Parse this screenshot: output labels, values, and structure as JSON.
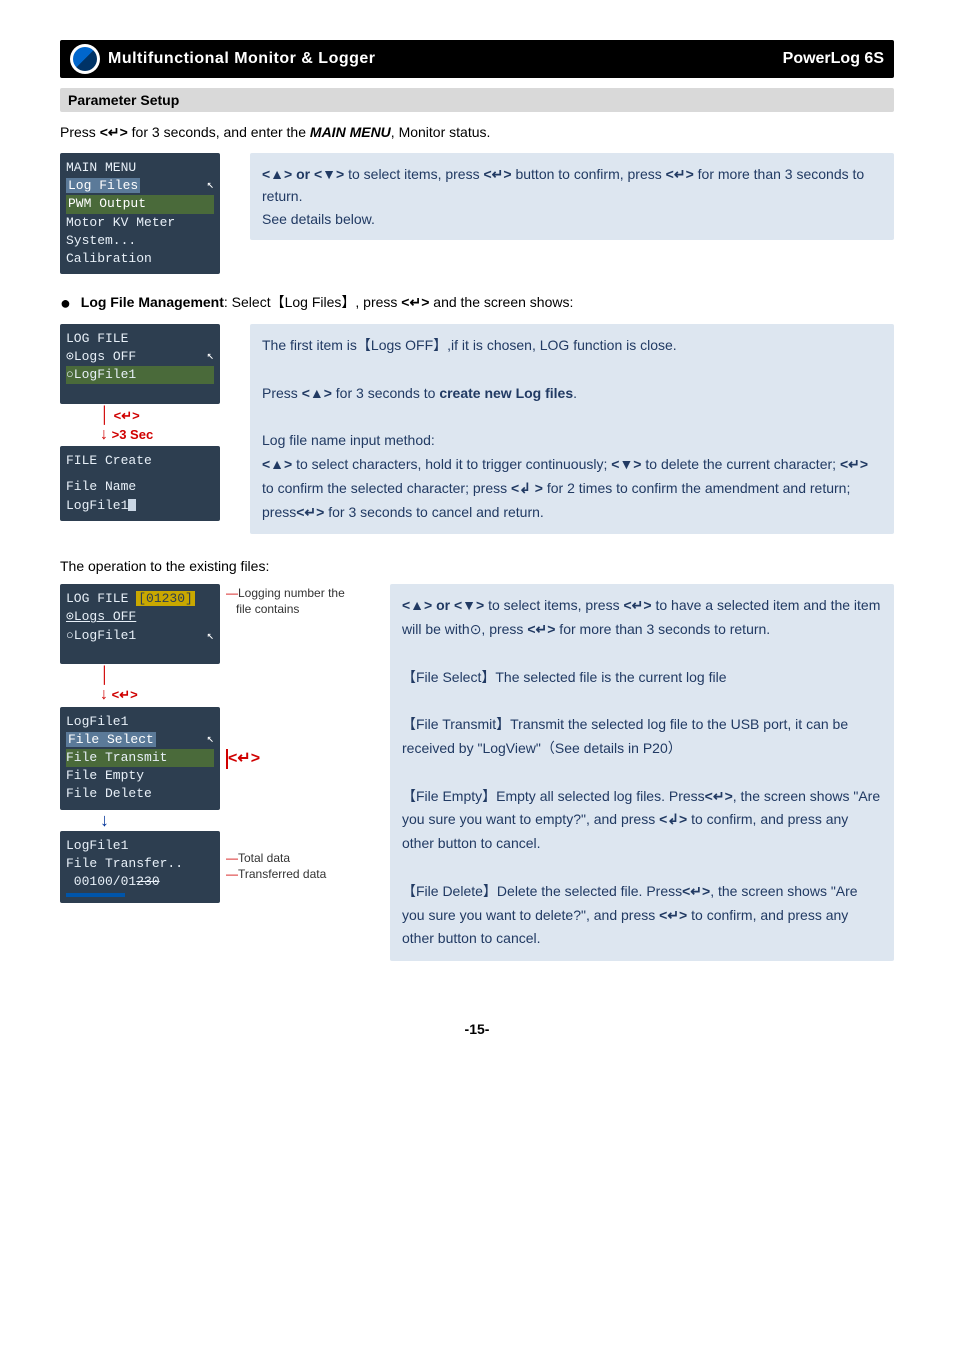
{
  "header": {
    "title": "Multifunctional  Monitor  &  Logger",
    "product": "PowerLog 6S"
  },
  "section_title": "Parameter Setup",
  "intro": {
    "pre": "Press ",
    "btn": "<↵>",
    "post": " for 3 seconds, and enter the ",
    "menu": "MAIN MENU",
    "tail": ", Monitor status."
  },
  "main_menu_lcd": {
    "title": "MAIN MENU",
    "items": [
      "Log Files",
      "PWM Output",
      "Motor KV Meter",
      "System...",
      "Calibration"
    ]
  },
  "main_menu_note": {
    "l1a": "<▲> or <▼>",
    "l1b": " to select items, press ",
    "l1c": "<↵>",
    "l1d": " button to confirm, press ",
    "l1e": "<↵>",
    "l2": "for more than 3 seconds to return.",
    "l3": "See details below."
  },
  "log_mgmt": {
    "label": "Log File Management",
    "mid": ": Select【Log Files】, press ",
    "btn": "<↵>",
    "tail": " and the screen shows:"
  },
  "log_file_lcd": {
    "title": "LOG FILE",
    "row1": "⊙Logs OFF",
    "row2": "○LogFile1"
  },
  "arrow_label": {
    "sym": "<↵>",
    "sec": ">3 Sec"
  },
  "file_create_lcd": {
    "title": "FILE Create",
    "row1": "File Name",
    "row2a": "LogFile1"
  },
  "log_note": {
    "p1a": "The first item is【Logs OFF】,if it is chosen, LOG function is close.",
    "p2a": "Press ",
    "p2b": "<▲>",
    "p2c": " for 3 seconds to ",
    "p2d": "create new Log files",
    "p2e": ".",
    "p3": "Log file name input method:",
    "p4a": "<▲>",
    "p4b": " to select characters, hold it to trigger continuously; ",
    "p4c": "<▼>",
    "p4d": " to delete the current character; ",
    "p4e": "<↵>",
    "p4f": " to confirm the selected character; press ",
    "p4g": "<↲ >",
    "p4h": " for 2 times to confirm the amendment and return; press",
    "p4i": "<↵>",
    "p4j": " for 3 seconds to cancel and return."
  },
  "op_heading": "The operation to the existing files:",
  "lcd2": {
    "title": "LOG FILE ",
    "count_open": "[",
    "count": "01230",
    "count_close": "]",
    "row1": "⊙Logs OFF",
    "row2": "○LogFile1"
  },
  "anno_logging": {
    "l1": "Logging number the",
    "l2": "file contains"
  },
  "arrow_mid": "<↵>",
  "lcd3": {
    "title": "LogFile1",
    "r1": "File Select",
    "r2": "File Transmit",
    "r3": "File Empty",
    "r4": "File Delete"
  },
  "arrow_red2": "<↵>",
  "lcd4": {
    "title": "LogFile1",
    "r1": "File Transfer..",
    "r2a": " 00100/01",
    "r2b": "230"
  },
  "anno_total": {
    "l1": "Total data",
    "l2": "Transferred data"
  },
  "right_note": {
    "p1a": "<▲> or <▼>",
    "p1b": " to select items, press ",
    "p1c": "<↵>",
    "p1d": " to have a selected item and the item will be with⊙, press ",
    "p1e": "<↵>",
    "p1f": " for more than 3 seconds to return.",
    "p2": "【File Select】The selected file is the current log file",
    "p3a": "【File Transmit】Transmit the selected log file to the USB port, it can be received by \"LogView\"（See details in P20）",
    "p4a": "【File Empty】Empty all selected log files. Press",
    "p4b": "<↵>",
    "p4c": ", the screen shows \"Are you sure you want to empty?\", and press ",
    "p4d": "<↲>",
    "p4e": " to confirm, and press any other button to cancel.",
    "p5a": "【File Delete】Delete the selected file. Press",
    "p5b": "<↵>",
    "p5c": ", the screen shows \"Are you sure you want to delete?\", and press ",
    "p5d": "<↵>",
    "p5e": " to confirm, and press any other button to cancel."
  },
  "page_num": "-15-"
}
